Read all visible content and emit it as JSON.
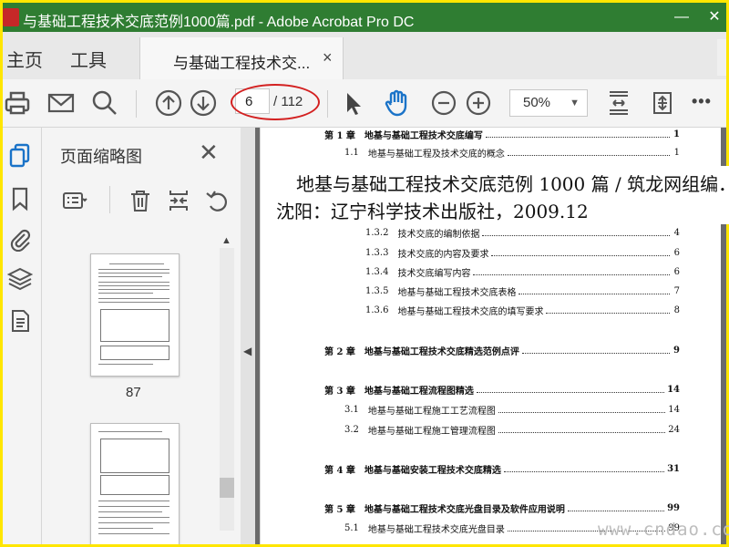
{
  "window": {
    "title": "与基础工程技术交底范例1000篇.pdf - Adobe Acrobat Pro DC",
    "controls": [
      "minimize",
      "close"
    ],
    "colors": {
      "titlebar": "#2f7d32",
      "border": "#ffe600",
      "annotation": "#d32020"
    }
  },
  "tabs": {
    "home": "主页",
    "tools": "工具",
    "document": "与基础工程技术交...",
    "close_glyph": "×"
  },
  "toolbar": {
    "icons": [
      "print-icon",
      "email-icon",
      "search-icon",
      "previous-page-icon",
      "next-page-icon",
      "select-pointer-icon",
      "hand-tool-icon",
      "zoom-out-icon",
      "zoom-in-icon",
      "fit-page-icon",
      "fullscreen-icon",
      "more-icon"
    ],
    "page_current": "6",
    "page_total": "/ 112",
    "zoom": "50%",
    "more_glyph": "•••"
  },
  "thumbnail_panel": {
    "title": "页面缩略图",
    "close_glyph": "✕",
    "tools": [
      "page-options-icon",
      "delete-icon",
      "insert-page-icon",
      "rotate-icon"
    ],
    "thumbnails": [
      {
        "label": "87"
      },
      {
        "label": ""
      }
    ]
  },
  "citation": {
    "line1": "地基与基础工程技术交底范例 1000 篇 / 筑龙网组编．",
    "line2": "沈阳：辽宁科学技术出版社，2009.12"
  },
  "toc": {
    "rows": [
      {
        "num": "第 1 章",
        "title": "地基与基础工程技术交底编写",
        "page": "1",
        "chapter": true
      },
      {
        "num": "1.1",
        "title": "地基与基础工程及技术交底的概念",
        "page": "1",
        "chapter": false
      },
      {
        "num": "1.3.2",
        "title": "技术交底的编制依据",
        "page": "4",
        "chapter": false
      },
      {
        "num": "1.3.3",
        "title": "技术交底的内容及要求",
        "page": "6",
        "chapter": false
      },
      {
        "num": "1.3.4",
        "title": "技术交底编写内容",
        "page": "6",
        "chapter": false
      },
      {
        "num": "1.3.5",
        "title": "地基与基础工程技术交底表格",
        "page": "7",
        "chapter": false
      },
      {
        "num": "1.3.6",
        "title": "地基与基础工程技术交底的填写要求",
        "page": "8",
        "chapter": false
      },
      {
        "num": "第 2 章",
        "title": "地基与基础工程技术交底精选范例点评",
        "page": "9",
        "chapter": true
      },
      {
        "num": "第 3 章",
        "title": "地基与基础工程流程图精选",
        "page": "14",
        "chapter": true
      },
      {
        "num": "3.1",
        "title": "地基与基础工程施工工艺流程图",
        "page": "14",
        "chapter": false
      },
      {
        "num": "3.2",
        "title": "地基与基础工程施工管理流程图",
        "page": "24",
        "chapter": false
      },
      {
        "num": "第 4 章",
        "title": "地基与基础安装工程技术交底精选",
        "page": "31",
        "chapter": true
      },
      {
        "num": "第 5 章",
        "title": "地基与基础工程技术交底光盘目录及软件应用说明",
        "page": "99",
        "chapter": true
      },
      {
        "num": "5.1",
        "title": "地基与基础工程技术交底光盘目录",
        "page": "99",
        "chapter": false
      }
    ]
  },
  "watermark": "www.cndao.com"
}
